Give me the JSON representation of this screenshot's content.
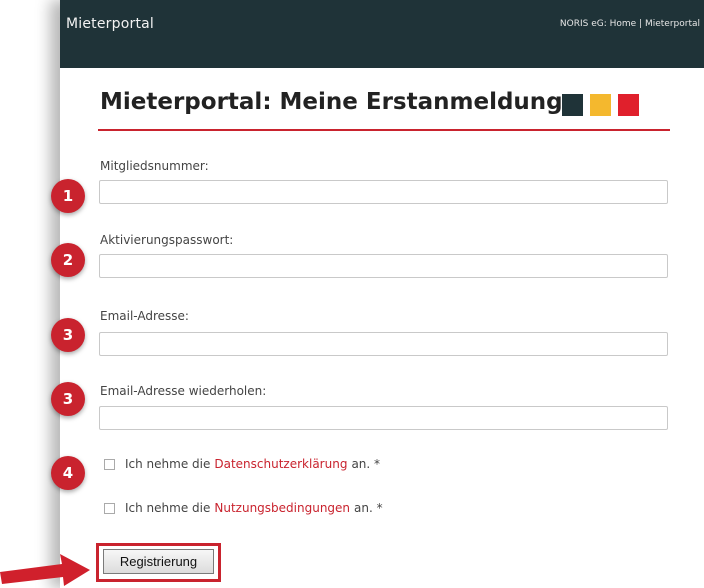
{
  "header": {
    "app_title": "Mieterportal",
    "links": [
      "NORIS eG: Home",
      "Mieterportal"
    ],
    "separator": " | "
  },
  "page": {
    "title": "Mieterportal: Meine Erstanmeldung",
    "swatch_colors": [
      "#1f3338",
      "#f4b82e",
      "#e0202c"
    ],
    "rule_color": "#c9232e"
  },
  "form": {
    "fields": [
      {
        "label": "Mitgliedsnummer:",
        "value": ""
      },
      {
        "label": "Aktivierungspasswort:",
        "value": ""
      },
      {
        "label": "Email-Adresse:",
        "value": ""
      },
      {
        "label": "Email-Adresse wiederholen:",
        "value": ""
      }
    ],
    "checkboxes": [
      {
        "prefix": "Ich nehme die",
        "link": "Datenschutzerklärung",
        "suffix": "an. *",
        "checked": false
      },
      {
        "prefix": "Ich nehme die",
        "link": "Nutzungsbedingungen",
        "suffix": "an. *",
        "checked": false
      }
    ],
    "submit_label": "Registrierung"
  },
  "annotations": {
    "badges": [
      "1",
      "2",
      "3",
      "3",
      "4"
    ],
    "accent": "#c9232e"
  }
}
